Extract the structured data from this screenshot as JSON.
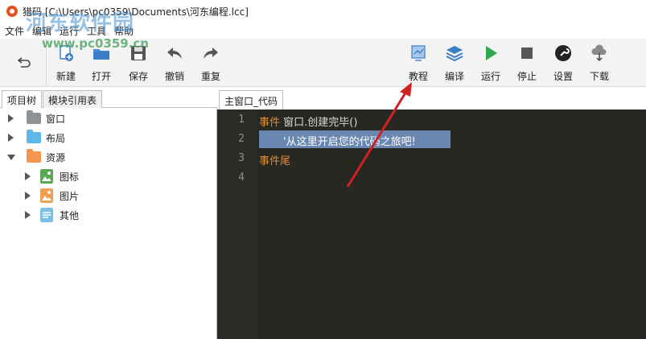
{
  "window": {
    "title": "猎码 [C:\\Users\\pc0359\\Documents\\河东编程.lcc]"
  },
  "watermark": {
    "title": "河东软件园",
    "url": "www.pc0359.cn"
  },
  "menu": {
    "items": [
      "文件",
      "编辑",
      "运行",
      "工具",
      "帮助"
    ]
  },
  "toolbar": {
    "undo_icon": "undo-arrow-icon",
    "left_buttons": [
      {
        "label": "新建",
        "icon": "new-file-icon"
      },
      {
        "label": "打开",
        "icon": "open-folder-icon"
      },
      {
        "label": "保存",
        "icon": "save-disk-icon"
      },
      {
        "label": "撤销",
        "icon": "undo-icon"
      },
      {
        "label": "重复",
        "icon": "redo-icon"
      }
    ],
    "right_buttons": [
      {
        "label": "教程",
        "icon": "tutorial-icon"
      },
      {
        "label": "编译",
        "icon": "layers-icon"
      },
      {
        "label": "运行",
        "icon": "play-icon"
      },
      {
        "label": "停止",
        "icon": "stop-icon"
      },
      {
        "label": "设置",
        "icon": "wrench-icon"
      },
      {
        "label": "下载",
        "icon": "cloud-download-icon"
      }
    ]
  },
  "left_panel": {
    "tabs": [
      "项目树",
      "模块引用表"
    ],
    "tree": [
      {
        "label": "窗口",
        "icon": "folder-gray-icon",
        "color": "#8e9399"
      },
      {
        "label": "布局",
        "icon": "folder-blue-icon",
        "color": "#5db8e8"
      },
      {
        "label": "资源",
        "icon": "folder-orange-icon",
        "color": "#f5954f"
      },
      {
        "label": "图标",
        "icon": "image-green-icon",
        "color": "#5aa653"
      },
      {
        "label": "图片",
        "icon": "image-orange-icon",
        "color": "#f0a050"
      },
      {
        "label": "其他",
        "icon": "document-blue-icon",
        "color": "#7cc0ea"
      }
    ]
  },
  "editor": {
    "tab": "主窗口_代码",
    "line_numbers": [
      "1",
      "2",
      "3",
      "4"
    ],
    "lines": {
      "l1_keyword": "事件",
      "l1_rest": " 窗口.创建完毕()",
      "l2_text": "'从这里开启您的代码之旅吧!",
      "l3_keyword": "事件尾"
    }
  },
  "colors": {
    "keyword": "#e28b36",
    "editor_bg": "#272822",
    "selection": "#6a87b2",
    "annotation_arrow": "#d42020"
  }
}
